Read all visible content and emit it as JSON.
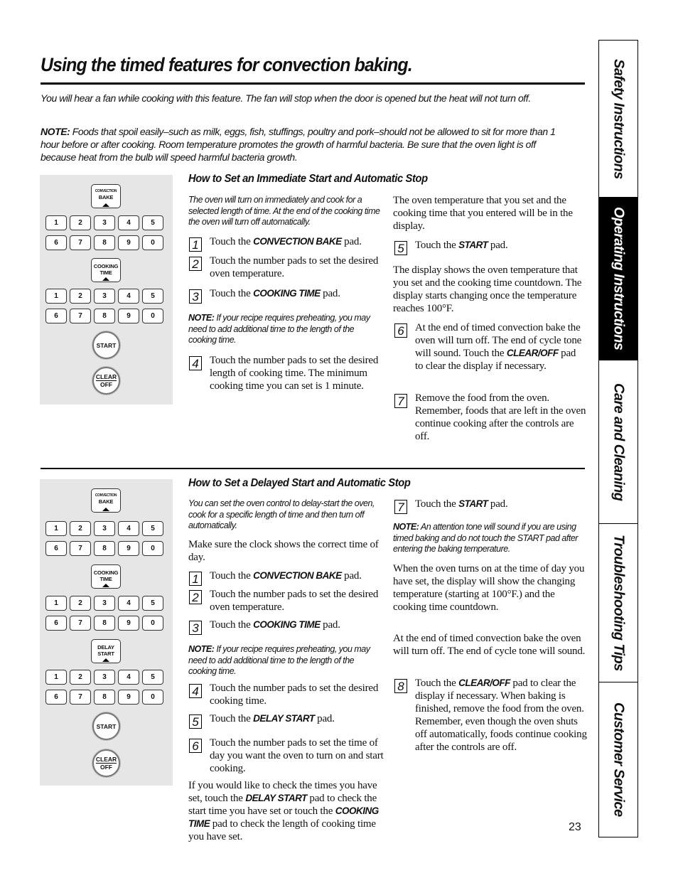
{
  "title": "Using the timed features for convection baking.",
  "intro": {
    "fan_text": "You will hear a fan while cooking with this feature. The fan will stop when the door is opened but the heat will not turn off.",
    "note_label": "NOTE:",
    "note_text": " Foods that spoil easily–such as milk, eggs, fish, stuffings, poultry and pork–should not be allowed to sit for more than 1 hour before or after cooking. Room temperature promotes the growth of harmful bacteria. Be sure that the oven light is off because heat from the bulb will speed harmful bacteria growth."
  },
  "keypad": {
    "convection_small": "CONVECTION",
    "convection_big": "BAKE",
    "cooking_l1": "COOKING",
    "cooking_l2": "TIME",
    "delay_l1": "DELAY",
    "delay_l2": "START",
    "row1": [
      "1",
      "2",
      "3",
      "4",
      "5"
    ],
    "row2": [
      "6",
      "7",
      "8",
      "9",
      "0"
    ],
    "start": "START",
    "clear": "CLEAR",
    "off": "OFF"
  },
  "section1": {
    "heading": "How to Set an Immediate Start and Automatic Stop",
    "lead": "The oven will turn on immediately and cook for a selected length of time. At the end of the cooking time the oven will turn off automatically.",
    "steps": [
      {
        "n": "1",
        "pre": "Touch the ",
        "kw": "CONVECTION BAKE",
        "post": " pad."
      },
      {
        "n": "2",
        "pre": "Touch the number pads to set the desired oven temperature.",
        "kw": "",
        "post": ""
      },
      {
        "n": "3",
        "pre": "Touch the ",
        "kw": "COOKING TIME",
        "post": " pad."
      },
      {
        "n": "4",
        "pre": "Touch the number pads to set the desired length of cooking time. The minimum cooking time you can set is 1 minute.",
        "kw": "",
        "post": ""
      },
      {
        "n": "5",
        "pre": "Touch the ",
        "kw": "START",
        "post": " pad."
      },
      {
        "n": "6",
        "pre": "At the end of timed convection bake the oven will turn off. The end of cycle tone will sound. Touch the ",
        "kw": "CLEAR/OFF",
        "post": " pad to clear the display if necessary."
      },
      {
        "n": "7",
        "pre": "Remove the food from the oven. Remember, foods that are left in the oven continue cooking after the controls are off.",
        "kw": "",
        "post": ""
      }
    ],
    "note_label": "NOTE:",
    "note_text": " If your recipe requires preheating, you may need to add additional time to the length of the cooking time.",
    "para_display": "The oven temperature that you set and the cooking time that you entered will be in the display.",
    "para_countdown": "The display shows the oven temperature that you set and the cooking time countdown. The display starts changing once the temperature reaches 100°F."
  },
  "section2": {
    "heading": "How to Set a Delayed Start and Automatic Stop",
    "lead": "You can set the oven control to delay-start the oven, cook for a specific length of time and then turn off automatically.",
    "para_clock": "Make sure the clock shows the correct time of day.",
    "steps": [
      {
        "n": "1",
        "pre": "Touch the ",
        "kw": "CONVECTION BAKE",
        "post": " pad."
      },
      {
        "n": "2",
        "pre": "Touch the number pads to set the desired oven temperature.",
        "kw": "",
        "post": ""
      },
      {
        "n": "3",
        "pre": "Touch the ",
        "kw": "COOKING TIME",
        "post": " pad."
      },
      {
        "n": "4",
        "pre": "Touch the number pads to set the desired cooking time.",
        "kw": "",
        "post": ""
      },
      {
        "n": "5",
        "pre": "Touch the ",
        "kw": "DELAY START",
        "post": " pad."
      },
      {
        "n": "6",
        "pre": "Touch the number pads to set the time of day you want the oven to turn on and start cooking.",
        "kw": "",
        "post": ""
      },
      {
        "n": "7",
        "pre": "Touch the ",
        "kw": "START",
        "post": " pad."
      },
      {
        "n": "8",
        "pre": "Touch the ",
        "kw": "CLEAR/OFF",
        "post": " pad to clear the display if necessary. When baking is finished, remove the food from the oven. Remember, even though the oven shuts off automatically, foods continue cooking after the controls are off."
      }
    ],
    "note1_label": "NOTE:",
    "note1_text": " If your recipe requires preheating, you may need to add additional time to the length of the cooking time.",
    "check": {
      "a": "If you would like to check the times you have set, touch the ",
      "kw1": "DELAY START",
      "b": " pad to check the start time you have set or touch the ",
      "kw2": "COOKING TIME",
      "c": " pad to check the length of cooking time you have set."
    },
    "note2_label": "NOTE:",
    "note2_text": " An attention tone will sound if you are using timed baking and do not touch the START pad after entering the baking temperature.",
    "para_turns_on": "When the oven turns on at the time of day you have set, the display will show the changing temperature (starting at 100°F.) and the cooking time countdown.",
    "para_end": "At the end of timed convection bake the oven will turn off. The end of cycle tone will sound."
  },
  "sidetabs": [
    {
      "label": "Safety Instructions",
      "active": false
    },
    {
      "label": "Operating Instructions",
      "active": true
    },
    {
      "label": "Care and Cleaning",
      "active": false
    },
    {
      "label": "Troubleshooting Tips",
      "active": false
    },
    {
      "label": "Customer Service",
      "active": false
    }
  ],
  "page_number": "23"
}
